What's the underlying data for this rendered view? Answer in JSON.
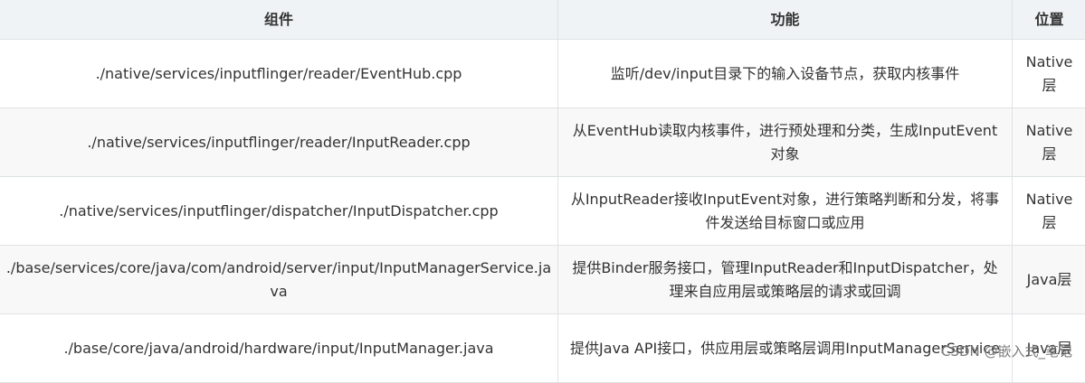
{
  "table": {
    "headers": [
      "组件",
      "功能",
      "位置"
    ],
    "rows": [
      {
        "component": "./native/services/inputflinger/reader/EventHub.cpp",
        "function": "监听/dev/input目录下的输入设备节点，获取内核事件",
        "location": "Native层"
      },
      {
        "component": "./native/services/inputflinger/reader/InputReader.cpp",
        "function": "从EventHub读取内核事件，进行预处理和分类，生成InputEvent对象",
        "location": "Native层"
      },
      {
        "component": "./native/services/inputflinger/dispatcher/InputDispatcher.cpp",
        "function": "从InputReader接收InputEvent对象，进行策略判断和分发，将事件发送给目标窗口或应用",
        "location": "Native层"
      },
      {
        "component": "./base/services/core/java/com/android/server/input/InputManagerService.java",
        "function": "提供Binder服务接口，管理InputReader和InputDispatcher，处理来自应用层或策略层的请求或回调",
        "location": "Java层"
      },
      {
        "component": "./base/core/java/android/hardware/input/InputManager.java",
        "function": "提供Java API接口，供应用层或策略层调用InputManagerService",
        "location": "Java层"
      }
    ]
  },
  "watermark": "CSDN @嵌入式_笔记"
}
